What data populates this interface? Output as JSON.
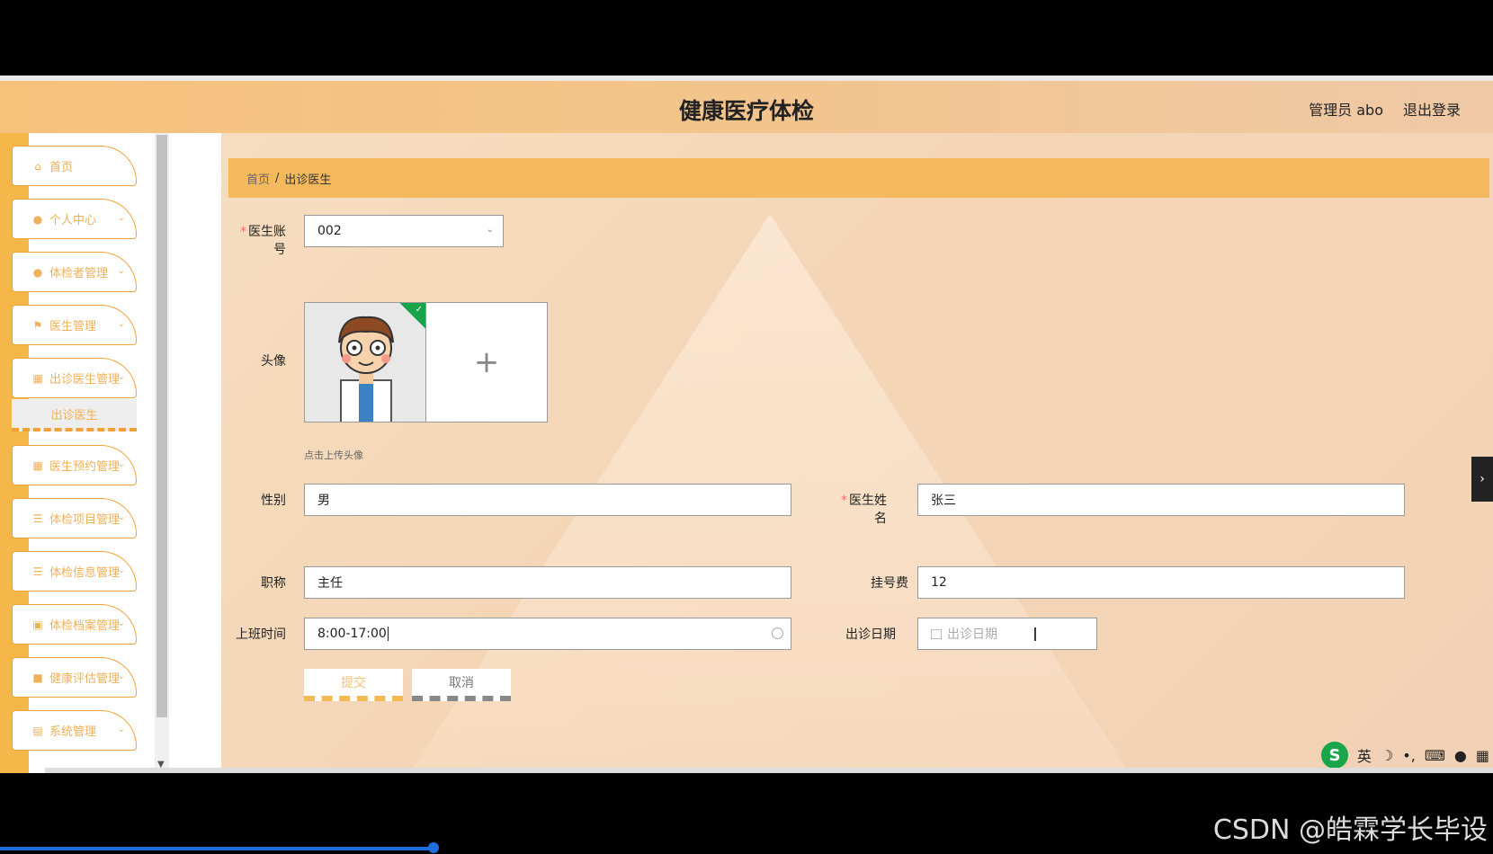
{
  "header": {
    "title": "健康医疗体检",
    "admin_label": "管理员 abo",
    "logout_label": "退出登录"
  },
  "sidebar": {
    "items": [
      {
        "label": "首页",
        "icon": "home-icon"
      },
      {
        "label": "个人中心",
        "icon": "user-icon"
      },
      {
        "label": "体检者管理",
        "icon": "user-icon"
      },
      {
        "label": "医生管理",
        "icon": "flag-icon"
      },
      {
        "label": "出诊医生管理",
        "icon": "grid-icon"
      },
      {
        "label": "医生预约管理",
        "icon": "grid-icon"
      },
      {
        "label": "体检项目管理",
        "icon": "list-icon"
      },
      {
        "label": "体检信息管理",
        "icon": "list-icon"
      },
      {
        "label": "体检档案管理",
        "icon": "archive-icon"
      },
      {
        "label": "健康评估管理",
        "icon": "chat-icon"
      },
      {
        "label": "系统管理",
        "icon": "book-icon"
      }
    ],
    "active_sub": "出诊医生"
  },
  "breadcrumb": {
    "home": "首页",
    "separator": "/",
    "current": "出诊医生"
  },
  "form": {
    "doctor_account_label_1": "医生账",
    "doctor_account_label_2": "号",
    "doctor_account_value": "002",
    "avatar_label": "头像",
    "upload_hint": "点击上传头像",
    "upload_plus": "+",
    "gender_label": "性别",
    "gender_value": "男",
    "doctor_name_label_1": "医生姓",
    "doctor_name_label_2": "名",
    "doctor_name_value": "张三",
    "title_label": "职称",
    "title_value": "主任",
    "fee_label": "挂号费",
    "fee_value": "12",
    "work_time_label": "上班时间",
    "work_time_value": "8:00-17:00",
    "date_label": "出诊日期",
    "date_placeholder": "出诊日期",
    "required_mark": "*",
    "submit_label": "提交",
    "cancel_label": "取消"
  },
  "ime": {
    "logo": "S",
    "mode": "英"
  },
  "watermark": "CSDN @皓霖学长毕设",
  "colors": {
    "sidebar_accent": "#f5b74a",
    "breadcrumb_bg": "#f4b95c",
    "required": "#f56c6c",
    "badge": "#16a34a"
  }
}
